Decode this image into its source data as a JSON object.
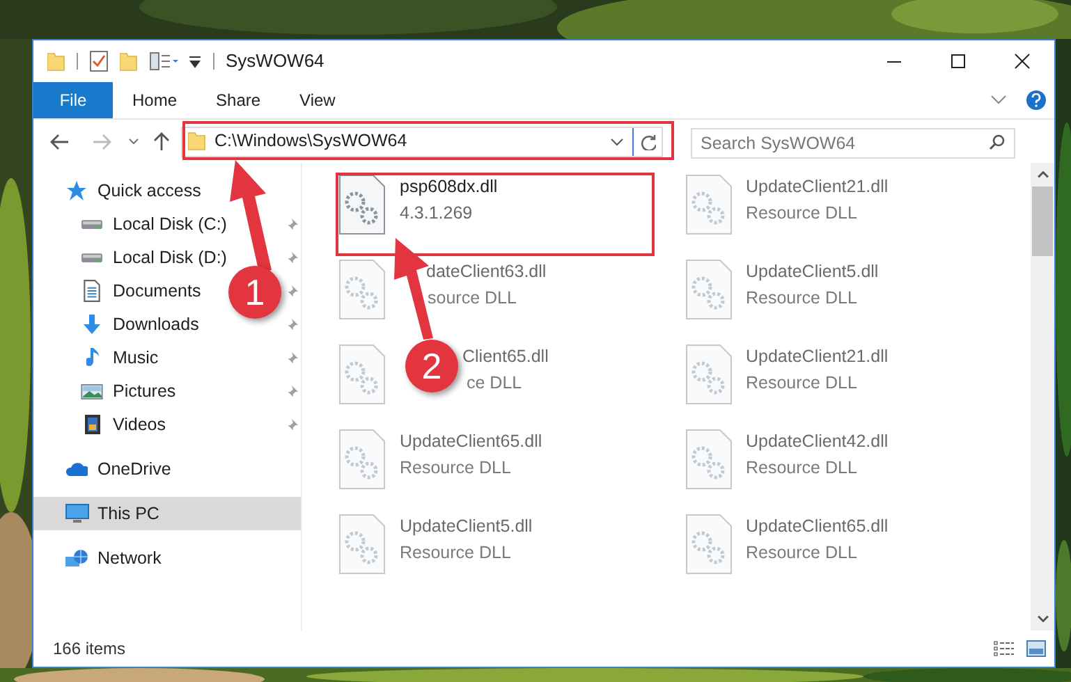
{
  "window": {
    "title": "SysWOW64"
  },
  "ribbon_tabs": [
    {
      "label": "File",
      "kind": "file"
    },
    {
      "label": "Home",
      "kind": "tab"
    },
    {
      "label": "Share",
      "kind": "tab"
    },
    {
      "label": "View",
      "kind": "tab"
    }
  ],
  "address_bar": {
    "path": "C:\\Windows\\SysWOW64"
  },
  "search": {
    "placeholder": "Search SysWOW64"
  },
  "nav_pane": [
    {
      "label": "Quick access",
      "kind": "star",
      "selected": false,
      "children": [
        {
          "label": "Local Disk (C:)",
          "kind": "drive",
          "pinned": true
        },
        {
          "label": "Local Disk (D:)",
          "kind": "drive",
          "pinned": true
        },
        {
          "label": "Documents",
          "kind": "document",
          "pinned": true
        },
        {
          "label": "Downloads",
          "kind": "download",
          "pinned": true
        },
        {
          "label": "Music",
          "kind": "music",
          "pinned": true
        },
        {
          "label": "Pictures",
          "kind": "pictures",
          "pinned": true
        },
        {
          "label": "Videos",
          "kind": "videos",
          "pinned": true
        }
      ]
    },
    {
      "label": "OneDrive",
      "kind": "cloud",
      "selected": false
    },
    {
      "label": "This PC",
      "kind": "pc",
      "selected": true
    },
    {
      "label": "Network",
      "kind": "network",
      "selected": false
    }
  ],
  "files": [
    {
      "name": "psp608dx.dll",
      "detail": "4.3.1.269",
      "blurred": false
    },
    {
      "name": "UpdateClient21.dll",
      "detail": "Resource DLL",
      "blurred": true
    },
    {
      "name": "dateClient63.dll",
      "detail": "source DLL",
      "blurred": true
    },
    {
      "name": "UpdateClient5.dll",
      "detail": "Resource DLL",
      "blurred": true
    },
    {
      "name": "Client65.dll",
      "detail": "ce DLL",
      "blurred": true
    },
    {
      "name": "UpdateClient21.dll",
      "detail": "Resource DLL",
      "blurred": true
    },
    {
      "name": "UpdateClient65.dll",
      "detail": "Resource DLL",
      "blurred": true
    },
    {
      "name": "UpdateClient42.dll",
      "detail": "Resource DLL",
      "blurred": true
    },
    {
      "name": "UpdateClient5.dll",
      "detail": "Resource DLL",
      "blurred": true
    },
    {
      "name": "UpdateClient65.dll",
      "detail": "Resource DLL",
      "blurred": true
    }
  ],
  "status_bar": {
    "item_count": "166 items"
  },
  "annotations": [
    {
      "label": "1"
    },
    {
      "label": "2"
    }
  ]
}
